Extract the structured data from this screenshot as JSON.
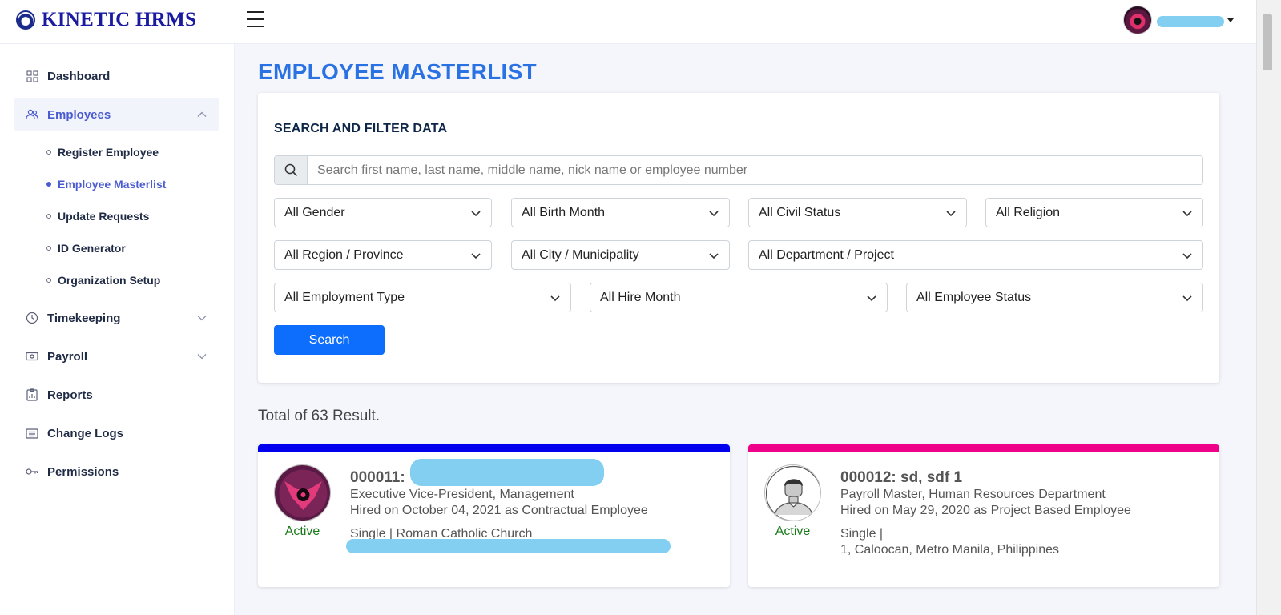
{
  "app": {
    "title": "KINETIC HRMS"
  },
  "sidebar": {
    "items": [
      {
        "label": "Dashboard"
      },
      {
        "label": "Employees"
      },
      {
        "label": "Timekeeping"
      },
      {
        "label": "Payroll"
      },
      {
        "label": "Reports"
      },
      {
        "label": "Change Logs"
      },
      {
        "label": "Permissions"
      }
    ],
    "employees_sub": [
      {
        "label": "Register Employee"
      },
      {
        "label": "Employee Masterlist"
      },
      {
        "label": "Update Requests"
      },
      {
        "label": "ID Generator"
      },
      {
        "label": "Organization Setup"
      }
    ]
  },
  "page": {
    "title": "EMPLOYEE MASTERLIST"
  },
  "filter": {
    "title": "SEARCH AND FILTER DATA",
    "search_placeholder": "Search first name, last name, middle name, nick name or employee number",
    "selects": {
      "gender": "All Gender",
      "birth_month": "All Birth Month",
      "civil_status": "All Civil Status",
      "religion": "All Religion",
      "region": "All Region / Province",
      "city": "All City / Municipality",
      "department": "All Department / Project",
      "employment_type": "All Employment Type",
      "hire_month": "All Hire Month",
      "employee_status": "All Employee Status"
    },
    "search_button": "Search"
  },
  "results": {
    "summary": "Total of 63 Result.",
    "employees": [
      {
        "id_name": "000011:",
        "position": "Executive Vice-President, Management",
        "hired": "Hired on October 04, 2021 as Contractual Employee",
        "civil_religion": "Single | Roman Catholic Church",
        "address": "",
        "status": "Active",
        "bar_color": "#0000ee"
      },
      {
        "id_name": "000012: sd, sdf 1",
        "position": "Payroll Master, Human Resources Department",
        "hired": "Hired on May 29, 2020 as Project Based Employee",
        "civil_religion": "Single |",
        "address": "1, Caloocan, Metro Manila, Philippines",
        "status": "Active",
        "bar_color": "#ee0088"
      }
    ]
  }
}
